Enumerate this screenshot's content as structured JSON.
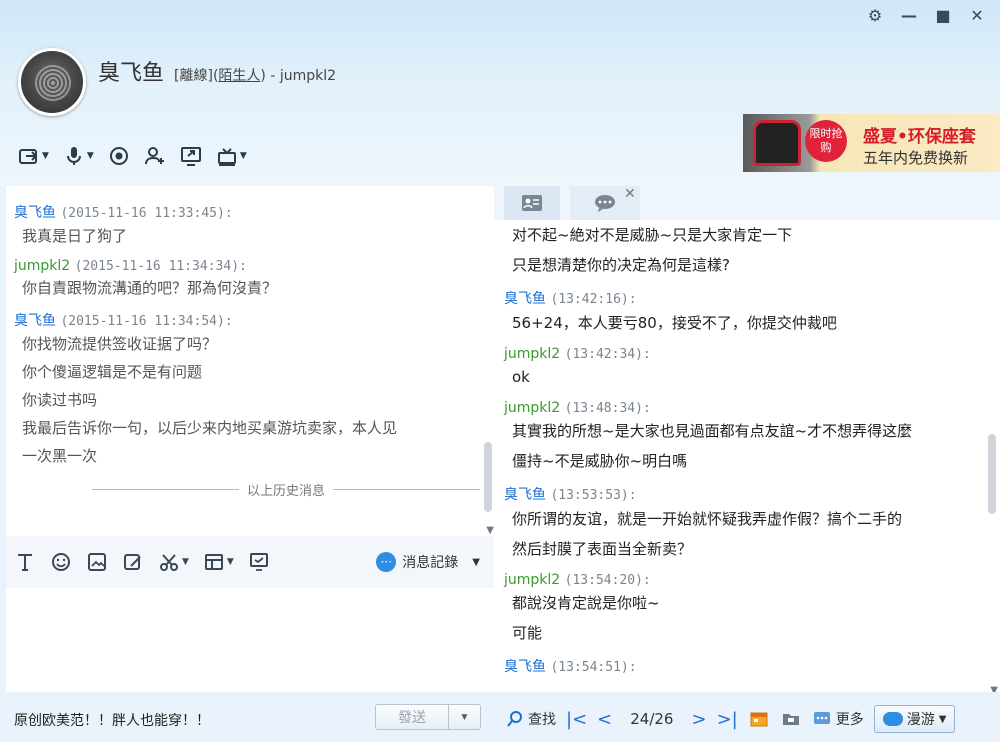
{
  "header": {
    "nickname": "臭飞鱼",
    "status": "[離線](",
    "relation": "陌生人",
    "account": ") - jumpkl2"
  },
  "ad": {
    "badge": "限时抢购",
    "title": "盛夏•环保座套",
    "subtitle": "五年内免费换新"
  },
  "left_chat": {
    "messages": [
      {
        "sender": "臭飞鱼",
        "time": "(2015-11-16 11:33:45):",
        "lines": [
          "我真是日了狗了"
        ]
      },
      {
        "sender": "jumpkl2",
        "time": "(2015-11-16 11:34:34):",
        "lines": [
          "你自責跟物流溝通的吧？那為何沒責？"
        ]
      },
      {
        "sender": "臭飞鱼",
        "time": "(2015-11-16 11:34:54):",
        "lines": [
          "你找物流提供签收证据了吗？",
          "你个傻逼逻辑是不是有问题",
          "你读过书吗",
          "我最后告诉你一句，以后少来内地买桌游坑卖家，本人见",
          "一次黑一次"
        ]
      }
    ],
    "history_label": "以上历史消息"
  },
  "input_tools": {
    "history_button": "消息記錄",
    "placeholder": ""
  },
  "bottom": {
    "promo": "原创欧美范！！胖人也能穿！！",
    "send": "發送"
  },
  "right_chat": {
    "top_lines": [
      "对不起~絶对不是威胁~只是大家肯定一下",
      "只是想清楚你的决定為何是這樣?"
    ],
    "messages": [
      {
        "sender": "臭飞鱼",
        "time": "(13:42:16):",
        "lines": [
          "56+24，本人要亏80，接受不了，你提交仲裁吧"
        ]
      },
      {
        "sender": "jumpkl2",
        "time": "(13:42:34):",
        "lines": [
          "ok"
        ]
      },
      {
        "sender": "jumpkl2",
        "time": "(13:48:34):",
        "lines": [
          "其實我的所想~是大家也見過面都有点友誼~才不想弄得这麼",
          "僵持~不是威胁你~明白嗎"
        ]
      },
      {
        "sender": "臭飞鱼",
        "time": "(13:53:53):",
        "lines": [
          "你所谓的友谊，就是一开始就怀疑我弄虚作假？搞个二手的",
          "然后封膜了表面当全新卖？"
        ]
      },
      {
        "sender": "jumpkl2",
        "time": "(13:54:20):",
        "lines": [
          "都說沒肯定說是你啦~",
          "可能"
        ]
      },
      {
        "sender": "臭飞鱼",
        "time": "(13:54:51):",
        "lines": []
      }
    ]
  },
  "right_bottom": {
    "search": "查找",
    "page": "24/26",
    "more": "更多",
    "roam": "漫游"
  },
  "colors": {
    "self_sender": "#1f6fd0",
    "peer_sender": "#3a9a2f",
    "accent": "#2d8ee3"
  }
}
